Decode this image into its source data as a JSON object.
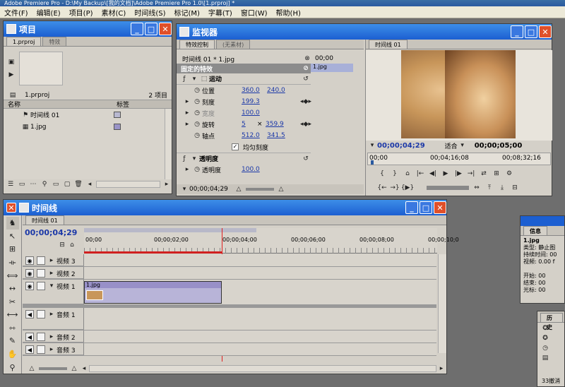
{
  "app": {
    "title": "Adobe Premiere Pro - D:\\My Backup\\[我的文档]\\Adobe Premiere Pro 1.0\\[1.prproj] *",
    "menu": [
      "文件(F)",
      "编辑(E)",
      "项目(P)",
      "素材(C)",
      "时间线(S)",
      "标记(M)",
      "字幕(T)",
      "窗口(W)",
      "帮助(H)"
    ]
  },
  "project": {
    "title": "项目",
    "tabs": [
      "1.prproj",
      "特效"
    ],
    "file_label": "1.prproj",
    "count": "2 项目",
    "col_name": "名称",
    "col_label": "标签",
    "items": [
      {
        "name": "时间线 01",
        "label_color": "#b8b8d0"
      },
      {
        "name": "1.jpg",
        "label_color": "#9a94c8"
      }
    ]
  },
  "monitor": {
    "title": "监视器",
    "tabs": [
      "特效控制",
      "(无素材)"
    ],
    "program_tab": "时间线 01",
    "seq_label": "时间线 01 * 1.jpg",
    "ruler_time": "00;00",
    "clip_label": "1.jpg",
    "fixed_effects": "固定的特效",
    "motion": "运动",
    "props": [
      {
        "name": "位置",
        "v1": "360.0",
        "v2": "240.0"
      },
      {
        "name": "刻度",
        "v1": "199.3",
        "v2": ""
      },
      {
        "name": "宽度",
        "v1": "100.0",
        "v2": ""
      },
      {
        "name": "旋转",
        "v1": "5",
        "x": "×",
        "v2": "359.9"
      },
      {
        "name": "轴点",
        "v1": "512.0",
        "v2": "341.5"
      }
    ],
    "uniform_scale": "均匀刻度",
    "opacity": "透明度",
    "opacity_prop": "透明度",
    "opacity_value": "100.0",
    "ec_time": "00;00;04;29",
    "prog_time": "00;00;04;29",
    "fit": "适合",
    "prog_duration": "00;00;05;00",
    "ruler": [
      "00;00",
      "00;04;16;08",
      "00;08;32;16"
    ]
  },
  "timeline": {
    "title": "时间线",
    "tab": "时间线 01",
    "time": "00;00;04;29",
    "ruler": [
      "00;00",
      "00;00;02;00",
      "00;00;04;00",
      "00;00;06;00",
      "00;00;08;00",
      "00;00;10;0"
    ],
    "video_tracks": [
      "视频 3",
      "视频 2",
      "视频 1"
    ],
    "audio_tracks": [
      "音频 1",
      "音频 2",
      "音频 3"
    ],
    "clip_label": "1.jpg",
    "progress_fraction": 0.39
  },
  "info": {
    "title": "信息",
    "file": "1.jpg",
    "rows": [
      "类型: 静止图",
      "持续时间: 00",
      "视频: 0.00 f",
      "开始: 00",
      "结束: 00",
      "光标: 00"
    ]
  },
  "history": {
    "title": "历史",
    "footer": "33撤消"
  }
}
